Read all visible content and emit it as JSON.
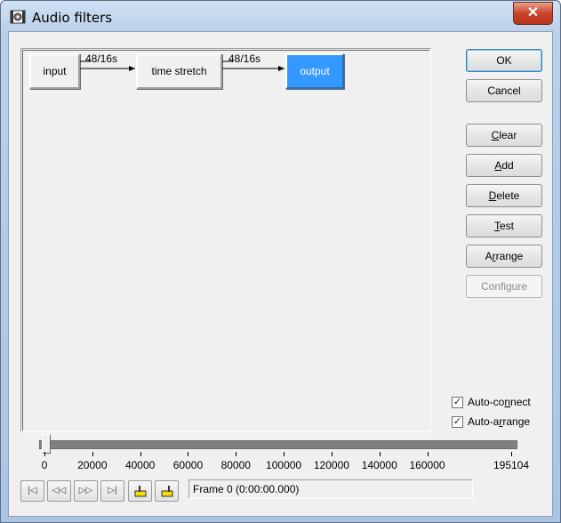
{
  "window": {
    "title": "Audio filters",
    "icon": "gear-film-icon",
    "close_label": "✕"
  },
  "graph": {
    "nodes": [
      {
        "label": "input",
        "selected": false
      },
      {
        "label": "time stretch",
        "selected": false
      },
      {
        "label": "output",
        "selected": true
      }
    ],
    "edges": [
      {
        "label": "48/16s"
      },
      {
        "label": "48/16s"
      }
    ]
  },
  "buttons": {
    "ok": "OK",
    "cancel": "Cancel",
    "clear": {
      "u": "C",
      "rest": "lear"
    },
    "add": {
      "u": "A",
      "rest": "dd"
    },
    "delete": {
      "u": "D",
      "rest": "elete"
    },
    "test": {
      "u": "T",
      "rest": "est"
    },
    "arrange": {
      "pre": "A",
      "u": "r",
      "rest": "range"
    },
    "configure": "Configure"
  },
  "options": {
    "auto_connect": {
      "pre": "Auto-co",
      "u": "n",
      "rest": "nect",
      "checked": true
    },
    "auto_arrange": {
      "pre": "Auto-a",
      "u": "r",
      "rest": "range",
      "checked": true
    }
  },
  "timeline": {
    "ticks": [
      "0",
      "20000",
      "40000",
      "60000",
      "80000",
      "100000",
      "120000",
      "140000",
      "160000",
      "195104"
    ],
    "position": 0,
    "max": 195104
  },
  "transport": {
    "buttons": [
      "start-icon",
      "rewind-icon",
      "fast-forward-icon",
      "end-icon",
      "mark-in-icon",
      "mark-out-icon"
    ]
  },
  "status": {
    "frame_text": "Frame 0 (0:00:00.000)"
  },
  "colors": {
    "selected_node": "#3399ff",
    "dialog_bg": "#f0f0f0",
    "close_button": "#c7442b"
  }
}
